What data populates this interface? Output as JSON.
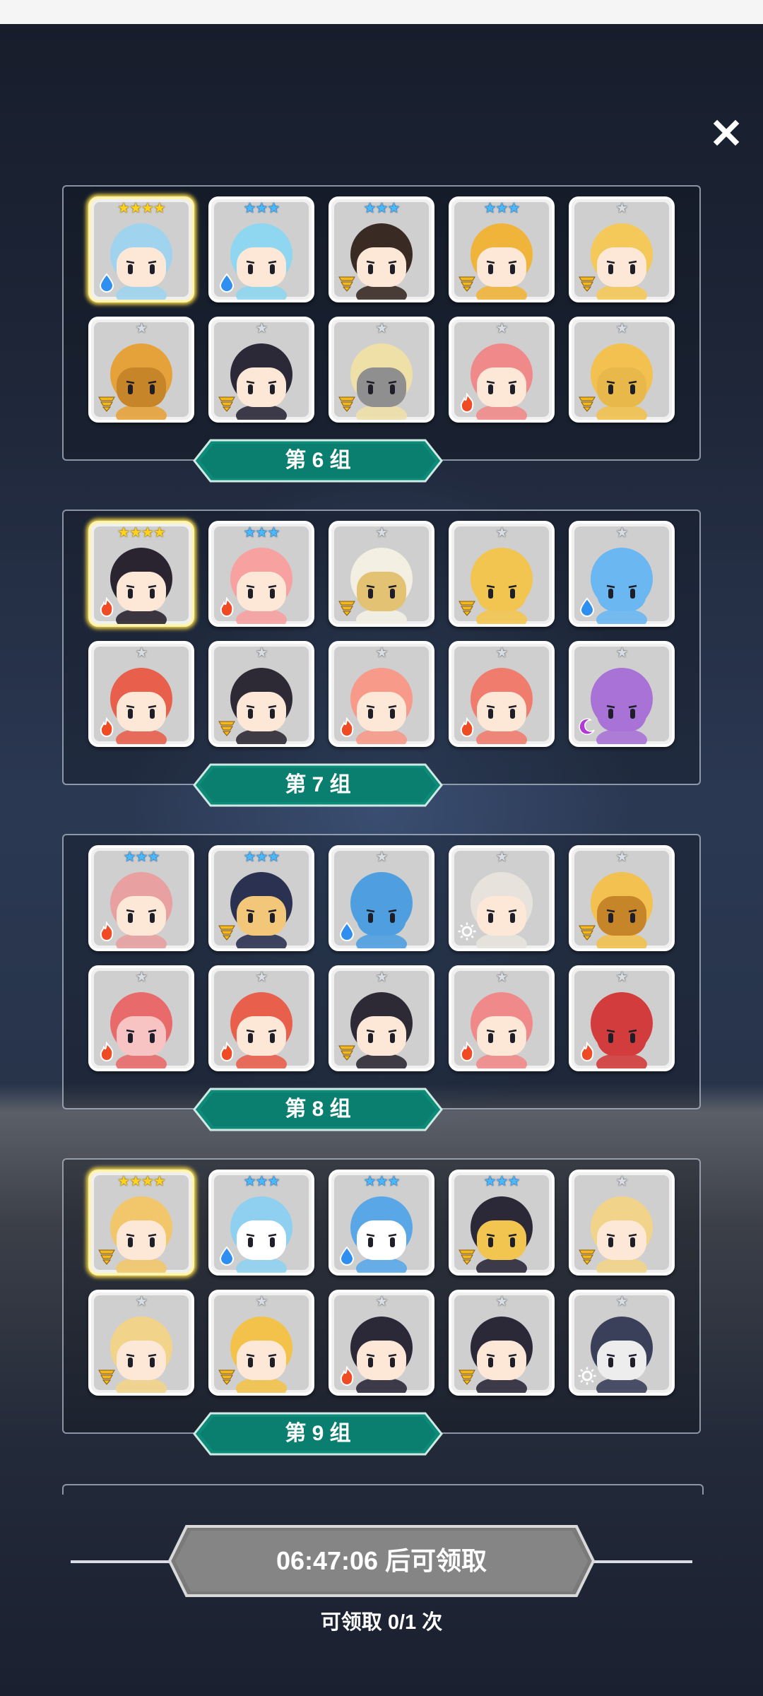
{
  "ui": {
    "close_icon": "close-icon",
    "claim_button_label": "06:47:06 后可领取",
    "claim_count_label": "可领取 0/1 次"
  },
  "groups": [
    {
      "label": "第 6 组",
      "cards": [
        {
          "stars": 4,
          "star_color": "gold",
          "element": "water",
          "legend": true,
          "hair": "#9fd3ee",
          "skin": "#fde8d8"
        },
        {
          "stars": 3,
          "star_color": "blue",
          "element": "water",
          "hair": "#8fd6f0",
          "skin": "#fde8d8"
        },
        {
          "stars": 3,
          "star_color": "blue",
          "element": "wind",
          "hair": "#3a2a24",
          "skin": "#fde8d8"
        },
        {
          "stars": 3,
          "star_color": "blue",
          "element": "wind",
          "hair": "#f0b43a",
          "skin": "#fde8d8"
        },
        {
          "stars": 1,
          "star_color": "silver",
          "element": "wind",
          "hair": "#f4c95a",
          "skin": "#fde8d8"
        },
        {
          "stars": 1,
          "star_color": "silver",
          "element": "wind",
          "hair": "#e6a23a",
          "skin": "#c7852a"
        },
        {
          "stars": 1,
          "star_color": "silver",
          "element": "wind",
          "hair": "#2b2838",
          "skin": "#fde8d8"
        },
        {
          "stars": 1,
          "star_color": "silver",
          "element": "wind",
          "hair": "#efe0a8",
          "skin": "#8f8f8f"
        },
        {
          "stars": 1,
          "star_color": "silver",
          "element": "fire",
          "hair": "#f08a8a",
          "skin": "#fde8d8"
        },
        {
          "stars": 1,
          "star_color": "silver",
          "element": "wind",
          "hair": "#f2c14f",
          "skin": "#e8b84a"
        }
      ]
    },
    {
      "label": "第 7 组",
      "cards": [
        {
          "stars": 4,
          "star_color": "gold",
          "element": "fire",
          "legend": true,
          "hair": "#2a2430",
          "skin": "#fde8d8"
        },
        {
          "stars": 3,
          "star_color": "blue",
          "element": "fire",
          "hair": "#f7a1a1",
          "skin": "#fde8d8"
        },
        {
          "stars": 1,
          "star_color": "silver",
          "element": "wind",
          "hair": "#f3efe3",
          "skin": "#e3c274"
        },
        {
          "stars": 1,
          "star_color": "silver",
          "element": "wind",
          "hair": "#f2c550",
          "skin": "#f2c550"
        },
        {
          "stars": 1,
          "star_color": "silver",
          "element": "water",
          "hair": "#6ab7f2",
          "skin": "#6ab7f2"
        },
        {
          "stars": 1,
          "star_color": "silver",
          "element": "fire",
          "hair": "#e85f4c",
          "skin": "#fde8d8"
        },
        {
          "stars": 1,
          "star_color": "silver",
          "element": "wind",
          "hair": "#2e2a35",
          "skin": "#fde8d8"
        },
        {
          "stars": 1,
          "star_color": "silver",
          "element": "fire",
          "hair": "#f79a8a",
          "skin": "#fde8d8"
        },
        {
          "stars": 1,
          "star_color": "silver",
          "element": "fire",
          "hair": "#f07c6e",
          "skin": "#fde8d8"
        },
        {
          "stars": 1,
          "star_color": "silver",
          "element": "dark",
          "hair": "#a872d6",
          "skin": "#a872d6"
        }
      ]
    },
    {
      "label": "第 8 组",
      "cards": [
        {
          "stars": 3,
          "star_color": "blue",
          "element": "fire",
          "hair": "#e8a0a0",
          "skin": "#fde8d8"
        },
        {
          "stars": 3,
          "star_color": "blue",
          "element": "wind",
          "hair": "#2b3150",
          "skin": "#f3c77a"
        },
        {
          "stars": 1,
          "star_color": "silver",
          "element": "water",
          "hair": "#4f9fe0",
          "skin": "#4f9fe0"
        },
        {
          "stars": 1,
          "star_color": "silver",
          "element": "light",
          "hair": "#e7e3dc",
          "skin": "#fde8d8"
        },
        {
          "stars": 1,
          "star_color": "silver",
          "element": "wind",
          "hair": "#f2c14f",
          "skin": "#c7852a"
        },
        {
          "stars": 1,
          "star_color": "silver",
          "element": "fire",
          "hair": "#e86a6a",
          "skin": "#f7c3c3"
        },
        {
          "stars": 1,
          "star_color": "silver",
          "element": "fire",
          "hair": "#e85f4c",
          "skin": "#fde8d8"
        },
        {
          "stars": 1,
          "star_color": "silver",
          "element": "wind",
          "hair": "#2e2a35",
          "skin": "#fde8d8"
        },
        {
          "stars": 1,
          "star_color": "silver",
          "element": "fire",
          "hair": "#f08a8a",
          "skin": "#fde8d8"
        },
        {
          "stars": 1,
          "star_color": "silver",
          "element": "fire",
          "hair": "#d23c3c",
          "skin": "#d23c3c"
        }
      ]
    },
    {
      "label": "第 9 组",
      "cards": [
        {
          "stars": 4,
          "star_color": "gold",
          "element": "wind",
          "legend": true,
          "hair": "#f2c66a",
          "skin": "#fde8d8"
        },
        {
          "stars": 3,
          "star_color": "blue",
          "element": "water",
          "hair": "#8fd0f0",
          "skin": "#ffffff"
        },
        {
          "stars": 3,
          "star_color": "blue",
          "element": "water",
          "hair": "#5aa7e8",
          "skin": "#ffffff"
        },
        {
          "stars": 3,
          "star_color": "blue",
          "element": "wind",
          "hair": "#2b2838",
          "skin": "#f2c550"
        },
        {
          "stars": 1,
          "star_color": "silver",
          "element": "wind",
          "hair": "#f2d38a",
          "skin": "#fde8d8"
        },
        {
          "stars": 1,
          "star_color": "silver",
          "element": "wind",
          "hair": "#f2d38a",
          "skin": "#fde8d8"
        },
        {
          "stars": 1,
          "star_color": "silver",
          "element": "wind",
          "hair": "#f2c24a",
          "skin": "#fde8d8"
        },
        {
          "stars": 1,
          "star_color": "silver",
          "element": "fire",
          "hair": "#2b2838",
          "skin": "#fde8d8"
        },
        {
          "stars": 1,
          "star_color": "silver",
          "element": "wind",
          "hair": "#2b2838",
          "skin": "#fde8d8"
        },
        {
          "stars": 1,
          "star_color": "silver",
          "element": "light",
          "hair": "#3a3f5a",
          "skin": "#ededed"
        }
      ]
    }
  ],
  "colors": {
    "label_fill": "#0d8a78",
    "label_fill_dark": "#0a6b5e",
    "button_fill": "#7d7d7d",
    "element_water": "#2f8ff0",
    "element_wind": "#f3b81f",
    "element_fire": "#ef4b25",
    "element_light": "#ffffff",
    "element_dark": "#b03ad6"
  }
}
